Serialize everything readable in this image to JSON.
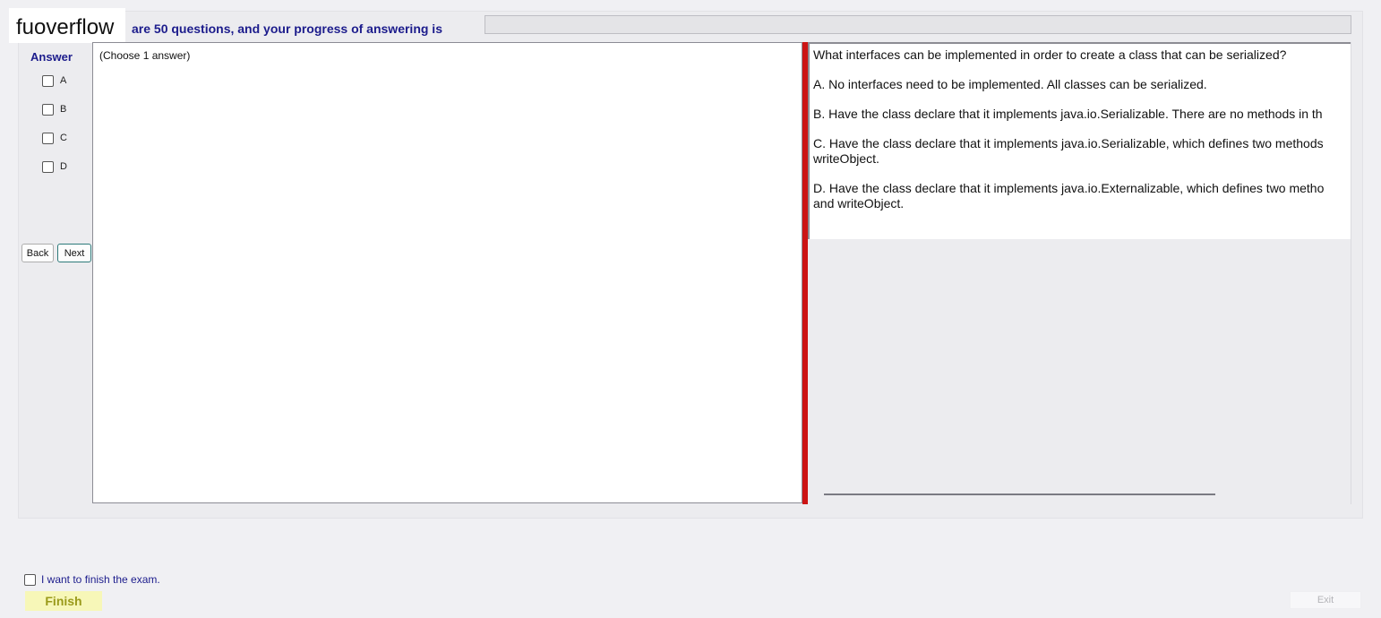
{
  "watermark": "fuoverflow",
  "header": {
    "progress_text": "are 50 questions, and your progress of answering is",
    "progress_percent": 0
  },
  "answer_panel": {
    "label": "Answer",
    "options": [
      "A",
      "B",
      "C",
      "D"
    ],
    "back_label": "Back",
    "next_label": "Next"
  },
  "answer_area": {
    "instruction": "(Choose 1 answer)"
  },
  "question": {
    "text": "What interfaces can be implemented in order to create a class that can be serialized?",
    "choices": [
      {
        "line1": "A.  No interfaces need to be implemented. All classes can be serialized.",
        "line2": ""
      },
      {
        "line1": "B.  Have the class declare that it implements java.io.Serializable. There are no methods in th",
        "line2": ""
      },
      {
        "line1": "C.  Have the class declare that it implements java.io.Serializable, which defines two methods",
        "line2": "writeObject."
      },
      {
        "line1": "D.  Have the class declare that it implements java.io.Externalizable, which defines two metho",
        "line2": "and writeObject."
      }
    ]
  },
  "footer": {
    "finish_checkbox_label": "I want to finish the exam.",
    "finish_label": "Finish",
    "exit_label": "Exit"
  },
  "colors": {
    "accent_text": "#1c1c8c",
    "splitter": "#cc1414",
    "finish_bg": "#f7f7b8"
  }
}
